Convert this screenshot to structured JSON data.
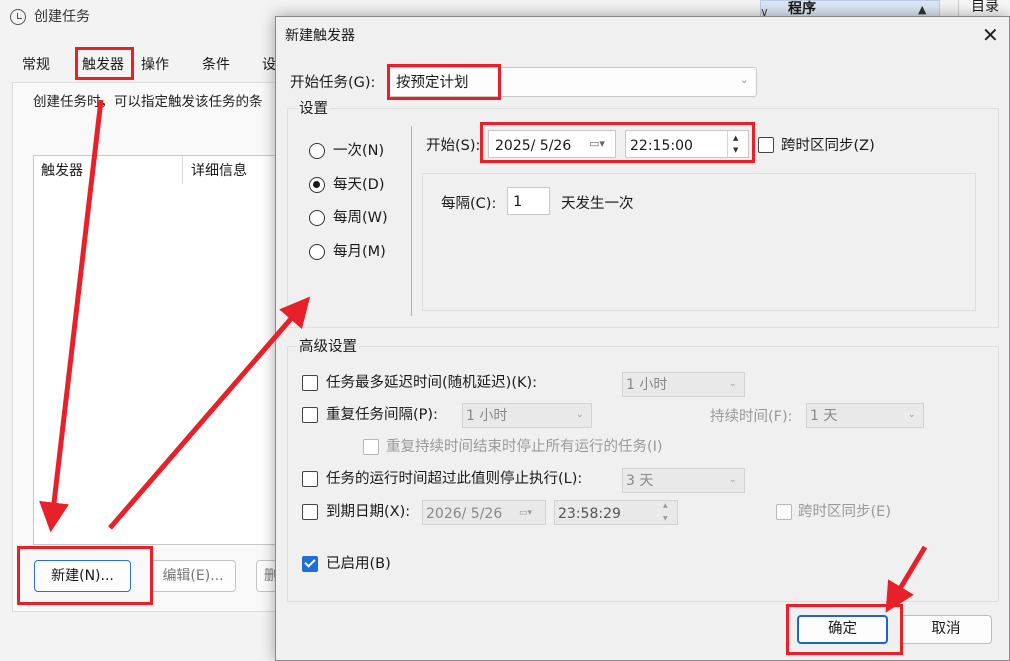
{
  "background_window": {
    "title": "创建任务",
    "tabs": [
      "常规",
      "触发器",
      "操作",
      "条件",
      "设"
    ],
    "description": "创建任务时，可以指定触发该任务的条",
    "list_columns": [
      "触发器",
      "详细信息"
    ],
    "buttons": {
      "new": "新建(N)...",
      "edit": "编辑(E)...",
      "delete": "删"
    },
    "right_header": "程序",
    "right_header_arrow": "▲",
    "chevron": "∨",
    "right_panel": "目录"
  },
  "dialog": {
    "title": "新建触发器",
    "close": "✕",
    "start_task_label": "开始任务(G):",
    "start_task_value": "按预定计划",
    "settings_label": "设置",
    "schedule_options": [
      "一次(N)",
      "每天(D)",
      "每周(W)",
      "每月(M)"
    ],
    "schedule_selected": "每天(D)",
    "start_label": "开始(S):",
    "start_date": "2025/  5/26",
    "start_time": "22:15:00",
    "sync_timezone_label": "跨时区同步(Z)",
    "every_label": "每隔(C):",
    "every_value": "1",
    "every_suffix": "天发生一次",
    "advanced_label": "高级设置",
    "advanced": {
      "delay_label": "任务最多延迟时间(随机延迟)(K):",
      "delay_value": "1 小时",
      "repeat_label": "重复任务间隔(P):",
      "repeat_value": "1 小时",
      "duration_label": "持续时间(F):",
      "duration_value": "1 天",
      "stop_all_label": "重复持续时间结束时停止所有运行的任务(I)",
      "stop_if_longer_label": "任务的运行时间超过此值则停止执行(L):",
      "stop_if_longer_value": "3 天",
      "expire_label": "到期日期(X):",
      "expire_date": "2026/  5/26",
      "expire_time": "23:58:29",
      "expire_sync_label": "跨时区同步(E)",
      "enabled_label": "已启用(B)",
      "enabled": true
    },
    "buttons": {
      "ok": "确定",
      "cancel": "取消"
    }
  },
  "colors": {
    "highlight": "#e8202a",
    "accent": "#1e6ed6"
  },
  "icons": [
    "clock-icon",
    "close-icon",
    "calendar-dropdown-icon",
    "spin-up-icon",
    "spin-down-icon",
    "dropdown-arrow-icon"
  ]
}
